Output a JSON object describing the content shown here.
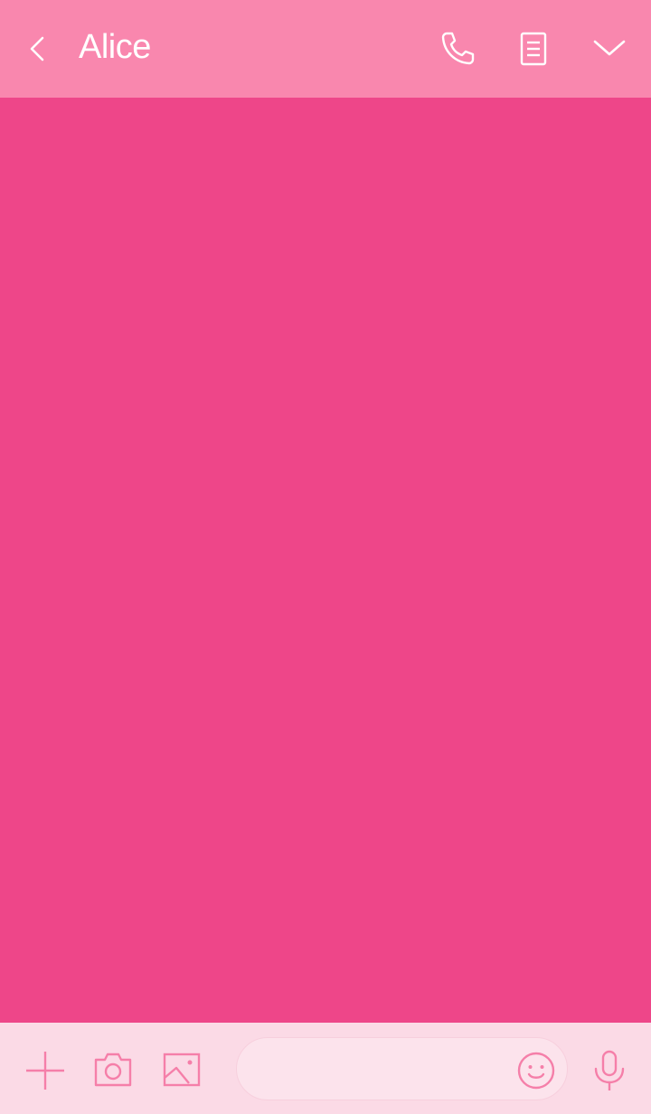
{
  "header": {
    "title": "Alice",
    "back_icon": "chevron-left-icon",
    "call_icon": "phone-icon",
    "notes_icon": "notes-icon",
    "more_icon": "chevron-down-icon"
  },
  "footer": {
    "plus_icon": "plus-icon",
    "camera_icon": "camera-icon",
    "image_icon": "image-icon",
    "emoji_icon": "smiley-icon",
    "mic_icon": "microphone-icon",
    "message_value": "",
    "message_placeholder": ""
  },
  "colors": {
    "header_bg": "#f987ae",
    "chat_bg": "#ee4689",
    "footer_bg": "#fbdae6",
    "input_bg": "#fce3ec",
    "footer_icon": "#f57fa9",
    "header_icon": "#ffffff"
  }
}
